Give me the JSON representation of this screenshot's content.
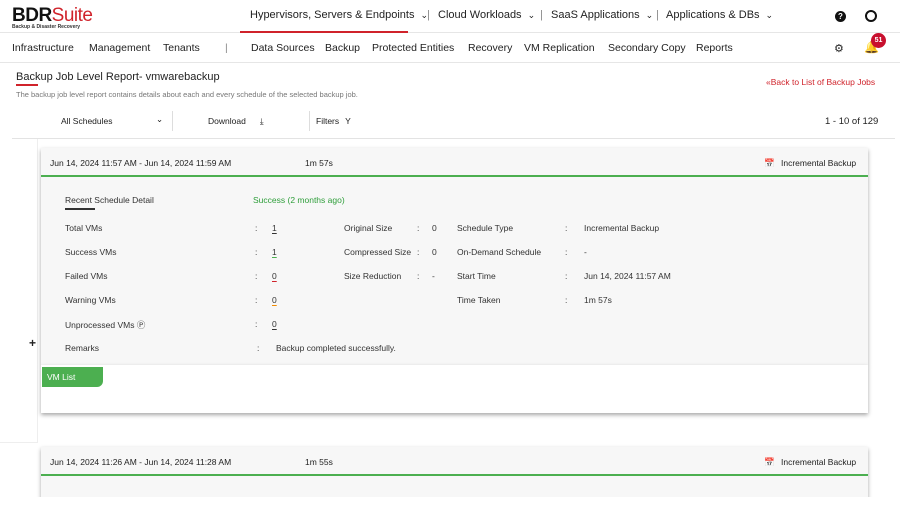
{
  "brand": {
    "name_a": "BDR",
    "name_b": "Suite",
    "tagline": "Backup & Disaster Recovery"
  },
  "products": [
    "Hypervisors, Servers & Endpoints",
    "Cloud Workloads",
    "SaaS Applications",
    "Applications & DBs"
  ],
  "nav_left": [
    "Infrastructure",
    "Management",
    "Tenants"
  ],
  "nav_right": [
    "Data Sources",
    "Backup",
    "Protected Entities",
    "Recovery",
    "VM Replication",
    "Secondary Copy",
    "Reports"
  ],
  "notifications": "51",
  "page": {
    "title": "Backup Job Level Report- vmwarebackup",
    "description": "The backup job level report contains details about each and every schedule of the selected backup job.",
    "back_link": "«Back to List of Backup Jobs"
  },
  "toolbar": {
    "schedules": "All Schedules",
    "download": "Download",
    "filters": "Filters",
    "pagination": "1 - 10 of 129"
  },
  "cards": [
    {
      "range": "Jun 14, 2024 11:57 AM - Jun 14, 2024 11:59 AM",
      "duration": "1m 57s",
      "type": "Incremental Backup",
      "section": "Recent Schedule Detail",
      "status": "Success  (2 months ago)",
      "left": [
        {
          "label": "Total VMs",
          "value": "1"
        },
        {
          "label": "Success VMs",
          "value": "1"
        },
        {
          "label": "Failed VMs",
          "value": "0"
        },
        {
          "label": "Warning VMs",
          "value": "0"
        },
        {
          "label": "Unprocessed VMs",
          "value": "0"
        }
      ],
      "remarks_label": "Remarks",
      "remarks": "Backup completed successfully.",
      "mid": [
        {
          "label": "Original Size",
          "value": "0"
        },
        {
          "label": "Compressed Size",
          "value": "0"
        },
        {
          "label": "Size Reduction",
          "value": "-"
        }
      ],
      "right": [
        {
          "label": "Schedule Type",
          "value": "Incremental Backup"
        },
        {
          "label": "On-Demand Schedule",
          "value": "-"
        },
        {
          "label": "Start Time",
          "value": "Jun 14, 2024 11:57 AM"
        },
        {
          "label": "Time Taken",
          "value": "1m 57s"
        }
      ],
      "vm_list": "VM List"
    },
    {
      "range": "Jun 14, 2024 11:26 AM - Jun 14, 2024 11:28 AM",
      "duration": "1m 55s",
      "type": "Incremental Backup"
    }
  ],
  "colors": {
    "accent": "#d0232b",
    "success": "#4caf50"
  }
}
